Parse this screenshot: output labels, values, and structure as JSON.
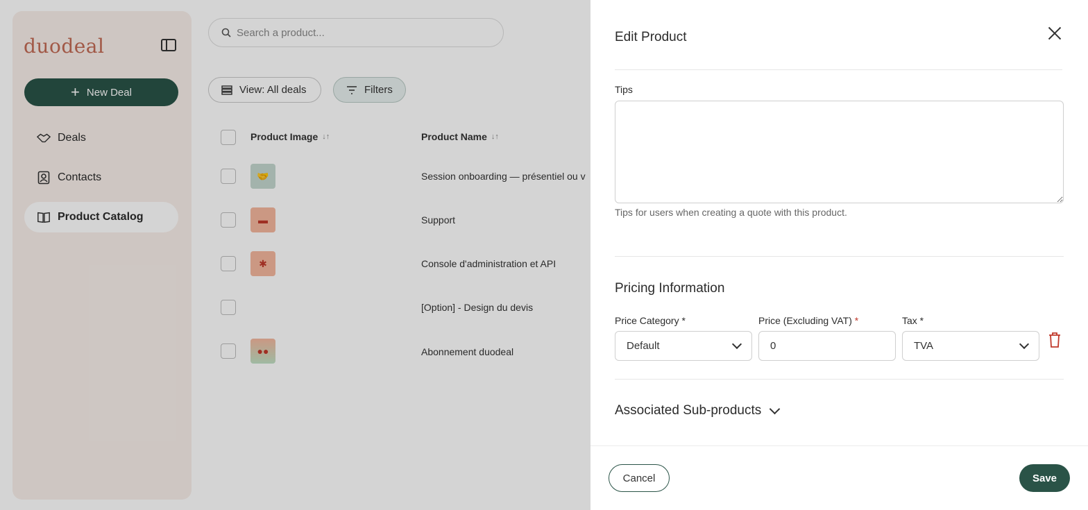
{
  "app": {
    "logo": "duodeal",
    "new_deal_label": "New Deal",
    "nav": [
      {
        "label": "Deals",
        "icon": "handshake-icon"
      },
      {
        "label": "Contacts",
        "icon": "contact-card-icon"
      },
      {
        "label": "Product Catalog",
        "icon": "book-icon"
      }
    ],
    "search_placeholder": "Search a product...",
    "view_label": "View: All deals",
    "filters_label": "Filters",
    "columns": [
      "Product Image",
      "Product Name"
    ],
    "rows": [
      {
        "name": "Session onboarding — présentiel ou v",
        "thumb_color": "#c5d8cf",
        "thumb_icon": "handshake-icon"
      },
      {
        "name": "Support",
        "thumb_color": "#f4b79e",
        "thumb_icon": "chat-icon"
      },
      {
        "name": "Console d'administration et API",
        "thumb_color": "#f4b79e",
        "thumb_icon": "gear-icon"
      },
      {
        "name": "[Option] - Design du devis",
        "thumb_color": "",
        "thumb_icon": ""
      },
      {
        "name": "Abonnement duodeal",
        "thumb_color": "#f4b79e",
        "thumb_icon": "people-icon"
      }
    ]
  },
  "drawer": {
    "title": "Edit Product",
    "tips_label": "Tips",
    "tips_value": "",
    "tips_helper": "Tips for users when creating a quote with this product.",
    "pricing_title": "Pricing Information",
    "price_category_label": "Price Category *",
    "price_category_value": "Default",
    "price_label": "Price (Excluding VAT)",
    "price_required": "*",
    "price_value": "0",
    "tax_label": "Tax *",
    "tax_value": "TVA",
    "sub_products_label": "Associated Sub-products",
    "cancel_label": "Cancel",
    "save_label": "Save"
  },
  "colors": {
    "brand_green": "#2a5347",
    "brand_logo": "#c26a55",
    "danger": "#c0392b"
  }
}
